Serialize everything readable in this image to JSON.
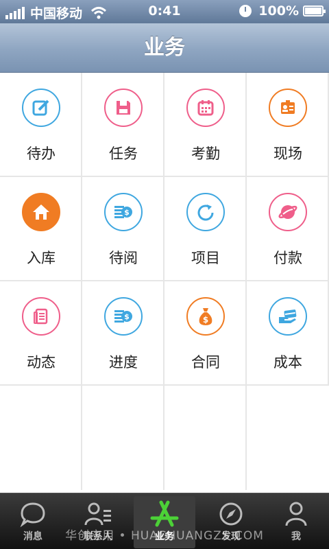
{
  "status_bar": {
    "carrier": "中国移动",
    "time": "0:41",
    "battery": "100%"
  },
  "nav": {
    "title": "业务"
  },
  "grid": {
    "items": [
      {
        "label": "待办",
        "icon": "edit-icon",
        "color": "#3fa7e0"
      },
      {
        "label": "任务",
        "icon": "floppy-icon",
        "color": "#ef5e8a"
      },
      {
        "label": "考勤",
        "icon": "calendar-icon",
        "color": "#ef5e8a"
      },
      {
        "label": "现场",
        "icon": "id-card-icon",
        "color": "#f07c23"
      },
      {
        "label": "入库",
        "icon": "home-icon",
        "color": "#f07c23"
      },
      {
        "label": "待阅",
        "icon": "coin-stack-icon",
        "color": "#3fa7e0"
      },
      {
        "label": "项目",
        "icon": "refresh-icon",
        "color": "#3fa7e0"
      },
      {
        "label": "付款",
        "icon": "planet-icon",
        "color": "#ef5e8a"
      },
      {
        "label": "动态",
        "icon": "document-icon",
        "color": "#ef5e8a"
      },
      {
        "label": "进度",
        "icon": "coin-stack-icon",
        "color": "#3fa7e0"
      },
      {
        "label": "合同",
        "icon": "money-bag-icon",
        "color": "#f07c23"
      },
      {
        "label": "成本",
        "icon": "card-hand-icon",
        "color": "#3fa7e0"
      }
    ]
  },
  "tabs": [
    {
      "label": "消息",
      "icon": "chat-bubble-icon"
    },
    {
      "label": "联系人",
      "icon": "contacts-icon"
    },
    {
      "label": "业务",
      "icon": "app-store-icon",
      "active": true
    },
    {
      "label": "发现",
      "icon": "compass-icon"
    },
    {
      "label": "我",
      "icon": "person-icon"
    }
  ],
  "watermark": "华创应用 • HUACHUANGZS.COM"
}
